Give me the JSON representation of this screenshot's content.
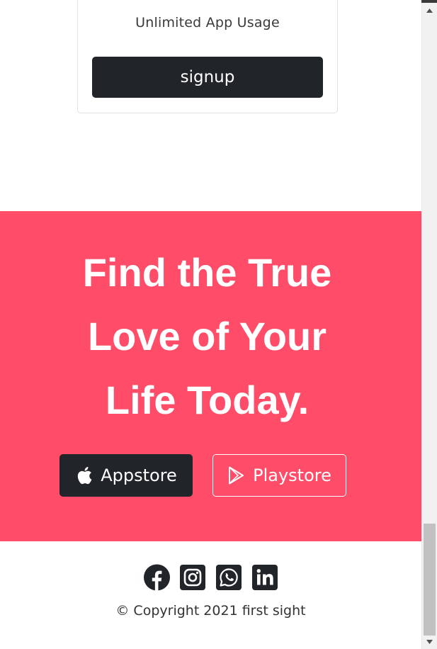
{
  "pricing": {
    "feature": "Unlimited App Usage",
    "signup_label": "signup"
  },
  "cta": {
    "title_line1": "Find the True",
    "title_line2": "Love of Your",
    "title_line3": "Life Today.",
    "appstore_label": "Appstore",
    "playstore_label": "Playstore",
    "background_color": "#ff4c68"
  },
  "footer": {
    "social_icons": [
      "facebook-icon",
      "instagram-icon",
      "whatsapp-icon",
      "linkedin-icon"
    ],
    "copyright": "© Copyright 2021 first sight"
  },
  "colors": {
    "dark": "#212529",
    "accent": "#ff4c68"
  }
}
